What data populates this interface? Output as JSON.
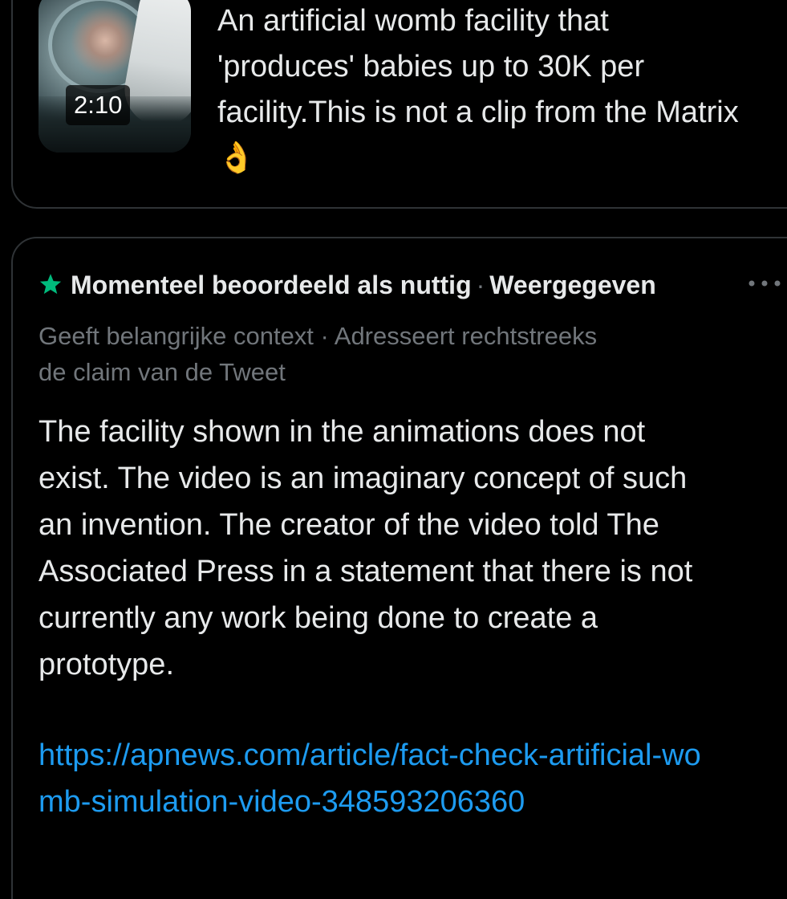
{
  "quoted_tweet": {
    "video_duration": "2:10",
    "text": "An artificial womb facility that 'produces' babies up to 30K per facility.This is not a clip from the Matrix 👌"
  },
  "community_note": {
    "status_label": "Momenteel beoordeeld als nuttig",
    "separator": "·",
    "shown_label": "Weergegeven",
    "criteria": "Geeft belangrijke context · Adresseert rechtstreeks de claim van de Tweet",
    "body": "The facility shown in the animations does not exist. The video is an imaginary concept of such an invention. The creator of the video told The Associated Press in a statement that there is not currently any work being done to create a prototype.",
    "link_text": "https://apnews.com/article/fact-check-artificial-womb-simulation-video-348593206360"
  },
  "colors": {
    "background": "#000000",
    "border": "#2f3336",
    "primary_text": "#e7e9ea",
    "secondary_text": "#71767b",
    "link": "#1d9bf0",
    "star": "#00ba7c"
  },
  "icons": {
    "status": "star-icon",
    "menu": "more-horizontal-icon"
  }
}
